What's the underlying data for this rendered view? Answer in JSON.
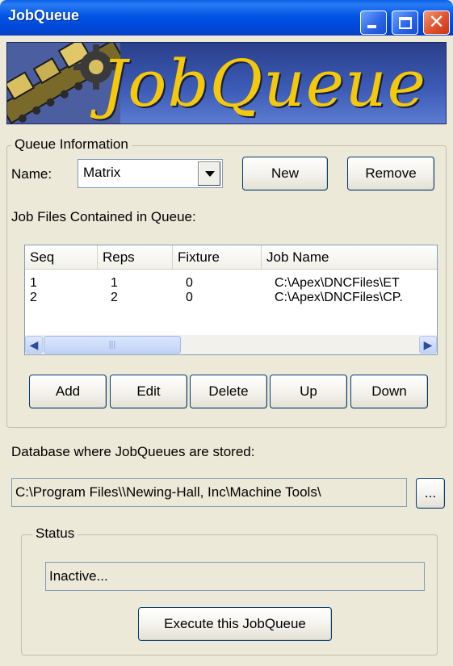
{
  "window": {
    "title": "JobQueue",
    "banner_title": "JobQueue",
    "controls": {
      "minimize": "minimize-icon",
      "maximize": "maximize-icon",
      "close": "close-icon"
    }
  },
  "queue_info": {
    "legend": "Queue Information",
    "name_label": "Name:",
    "name_value": "Matrix",
    "new_label": "New",
    "remove_label": "Remove",
    "jobs_label": "Job Files Contained in Queue:",
    "columns": [
      "Seq",
      "Reps",
      "Fixture",
      "Job Name"
    ],
    "rows": [
      {
        "seq": "1",
        "reps": "1",
        "fixture": "0",
        "job_name": "C:\\Apex\\DNCFiles\\ET"
      },
      {
        "seq": "2",
        "reps": "2",
        "fixture": "0",
        "job_name": "C:\\Apex\\DNCFiles\\CP."
      }
    ],
    "buttons": {
      "add": "Add",
      "edit": "Edit",
      "delete": "Delete",
      "up": "Up",
      "down": "Down"
    }
  },
  "database": {
    "label": "Database where JobQueues are stored:",
    "path": "C:\\Program Files\\\\Newing-Hall, Inc\\Machine Tools\\",
    "browse_label": "..."
  },
  "status": {
    "legend": "Status",
    "text": "Inactive...",
    "execute_label": "Execute this JobQueue"
  },
  "colors": {
    "titlebar": "#0055e5",
    "dialog_bg": "#ece9d8",
    "banner_text": "#f5c80a",
    "close_button": "#e0512c"
  }
}
